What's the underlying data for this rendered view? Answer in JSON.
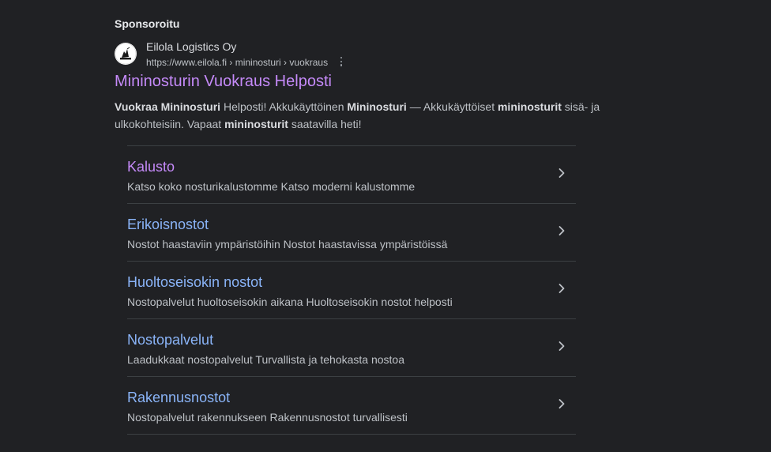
{
  "ad": {
    "sponsored_label": "Sponsoroitu",
    "advertiser": "Eilola Logistics Oy",
    "url": "https://www.eilola.fi › mininosturi › vuokraus",
    "favicon_icon": "eilola-logo-icon",
    "headline": "Mininosturin Vuokraus Helposti",
    "description": {
      "p1_bold": "Vuokraa Mininosturi",
      "p2": " Helposti! Akkukäyttöinen ",
      "p3_bold": "Mininosturi",
      "p4": " — Akkukäyttöiset ",
      "p5_bold": "mininosturit",
      "p6": " sisä- ja ulkokohteisiin. Vapaat ",
      "p7_bold": "mininosturit",
      "p8": " saatavilla heti!"
    }
  },
  "sitelinks": [
    {
      "title": "Kalusto",
      "description": "Katso koko nosturikalustomme Katso moderni kalustomme",
      "visited": true
    },
    {
      "title": "Erikoisnostot",
      "description": "Nostot haastaviin ympäristöihin Nostot haastavissa ympäristöissä",
      "visited": false
    },
    {
      "title": "Huoltoseisokin nostot",
      "description": "Nostopalvelut huoltoseisokin aikana Huoltoseisokin nostot helposti",
      "visited": false
    },
    {
      "title": "Nostopalvelut",
      "description": "Laadukkaat nostopalvelut Turvallista ja tehokasta nostoa",
      "visited": false
    },
    {
      "title": "Rakennusnostot",
      "description": "Nostopalvelut rakennukseen Rakennusnostot turvallisesti",
      "visited": false
    }
  ],
  "icons": {
    "more": "more-vert-icon",
    "chevron": "chevron-right-icon"
  },
  "colors": {
    "background": "#202124",
    "link": "#8ab4f8",
    "visited_link": "#c58af9",
    "text": "#bdc1c6",
    "divider": "#3c4043"
  }
}
